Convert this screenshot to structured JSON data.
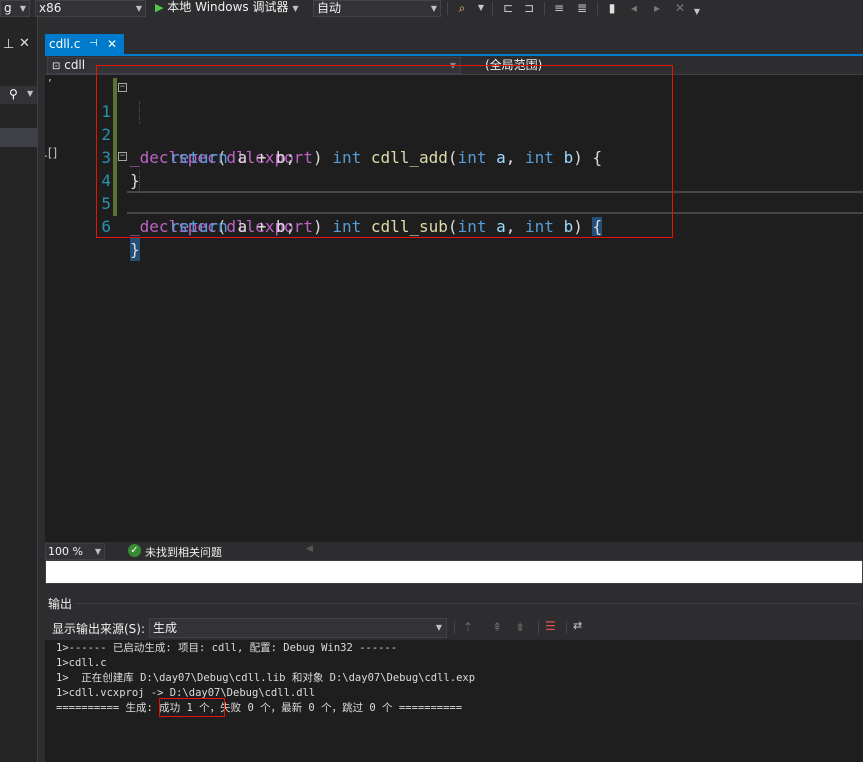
{
  "toolbar": {
    "config_value": "g",
    "platform_value": "x86",
    "run_label": "本地 Windows 调试器",
    "run_icon": "play-icon",
    "auto_value": "自动"
  },
  "left_panel": {
    "pin_icon": "pin-icon",
    "close_icon": "close-icon",
    "search_icon": "search-icon",
    "top_text": "’",
    "mid_text": ".[]"
  },
  "tab": {
    "label": "cdll.c",
    "pin_glyph": "⊣",
    "close_glyph": "✕"
  },
  "navbar": {
    "file_value": "cdll",
    "scope_value": "(全局范围)"
  },
  "code": {
    "lines": [
      {
        "n": "1",
        "fold": true
      },
      {
        "n": "2",
        "fold": false
      },
      {
        "n": "3",
        "fold": false
      },
      {
        "n": "4",
        "fold": true
      },
      {
        "n": "5",
        "fold": false
      },
      {
        "n": "6",
        "fold": false
      }
    ],
    "line1": {
      "macro": "_declspec",
      "arg": "dllexport",
      "t": "int",
      "fname": "cdll_add",
      "p1t": "int",
      "p1": "a",
      "p2t": "int",
      "p2": "b",
      "brace": "{"
    },
    "line2": {
      "kw": "return",
      "expr": "a + b;"
    },
    "line3": {
      "brace": "}"
    },
    "line4": {
      "macro": "_declspec",
      "arg": "dllexport",
      "t": "int",
      "fname": "cdll_sub",
      "p1t": "int",
      "p1": "a",
      "p2t": "int",
      "p2": "b",
      "brace": "{"
    },
    "line5": {
      "kw": "return",
      "expr": "a + b;"
    },
    "line6": {
      "brace": "}"
    }
  },
  "editor_status": {
    "zoom": "100 %",
    "issues_label": "未找到相关问题"
  },
  "output": {
    "title": "输出",
    "source_label": "显示输出来源(S):",
    "source_value": "生成",
    "lines": [
      "1>------ 已启动生成: 项目: cdll, 配置: Debug Win32 ------",
      "1>cdll.c",
      "1>  正在创建库 D:\\day07\\Debug\\cdll.lib 和对象 D:\\day07\\Debug\\cdll.exp",
      "1>cdll.vcxproj -> D:\\day07\\Debug\\cdll.dll",
      "========== 生成: 成功 1 个，失败 0 个，最新 0 个，跳过 0 个 =========="
    ]
  },
  "colors": {
    "accent": "#007acc",
    "editor_bg": "#1e1e1e",
    "highlight_box": "#e51400",
    "change_bar": "#577430"
  }
}
